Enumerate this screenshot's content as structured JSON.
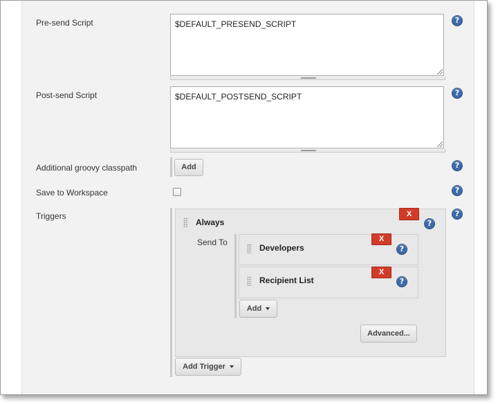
{
  "fields": {
    "presend": {
      "label": "Pre-send Script",
      "value": "$DEFAULT_PRESEND_SCRIPT"
    },
    "postsend": {
      "label": "Post-send Script",
      "value": "$DEFAULT_POSTSEND_SCRIPT"
    },
    "classpath": {
      "label": "Additional groovy classpath",
      "add_label": "Add"
    },
    "workspace": {
      "label": "Save to Workspace",
      "checked": false
    },
    "triggers": {
      "label": "Triggers"
    }
  },
  "trigger": {
    "name": "Always",
    "remove_label": "X",
    "send_to_label": "Send To",
    "recipients": [
      {
        "name": "Developers",
        "remove_label": "X"
      },
      {
        "name": "Recipient List",
        "remove_label": "X"
      }
    ],
    "add_label": "Add",
    "advanced_label": "Advanced..."
  },
  "add_trigger_label": "Add Trigger",
  "help_glyph": "?",
  "icons": {
    "help": "question-circle-icon",
    "remove": "x-icon",
    "drag": "drag-handle-icon",
    "dropdown": "caret-down-icon"
  },
  "colors": {
    "help_blue": "#3d6aa8",
    "remove_red": "#d23b2a",
    "background": "#f2f2f2"
  }
}
